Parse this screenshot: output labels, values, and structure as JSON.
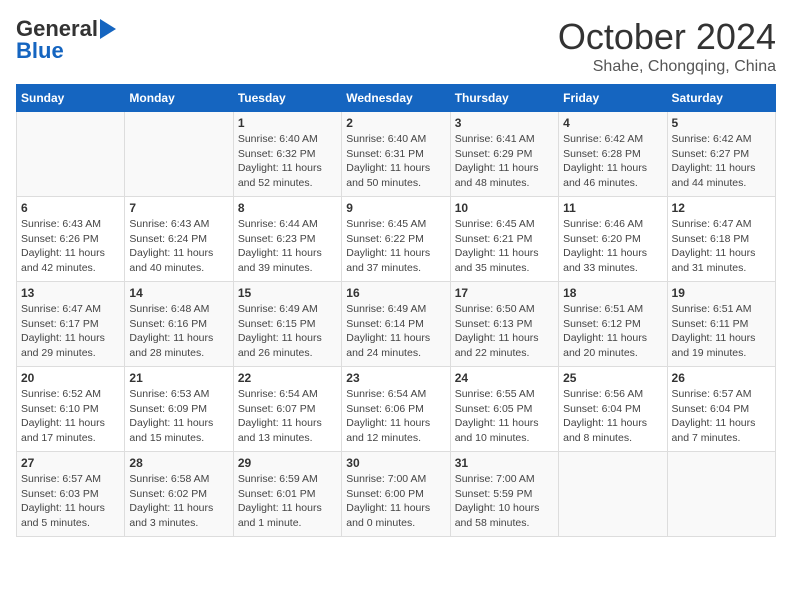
{
  "logo": {
    "general": "General",
    "blue": "Blue"
  },
  "title": {
    "month_year": "October 2024",
    "location": "Shahe, Chongqing, China"
  },
  "days_of_week": [
    "Sunday",
    "Monday",
    "Tuesday",
    "Wednesday",
    "Thursday",
    "Friday",
    "Saturday"
  ],
  "weeks": [
    [
      {
        "day": "",
        "info": ""
      },
      {
        "day": "",
        "info": ""
      },
      {
        "day": "1",
        "info": "Sunrise: 6:40 AM\nSunset: 6:32 PM\nDaylight: 11 hours and 52 minutes."
      },
      {
        "day": "2",
        "info": "Sunrise: 6:40 AM\nSunset: 6:31 PM\nDaylight: 11 hours and 50 minutes."
      },
      {
        "day": "3",
        "info": "Sunrise: 6:41 AM\nSunset: 6:29 PM\nDaylight: 11 hours and 48 minutes."
      },
      {
        "day": "4",
        "info": "Sunrise: 6:42 AM\nSunset: 6:28 PM\nDaylight: 11 hours and 46 minutes."
      },
      {
        "day": "5",
        "info": "Sunrise: 6:42 AM\nSunset: 6:27 PM\nDaylight: 11 hours and 44 minutes."
      }
    ],
    [
      {
        "day": "6",
        "info": "Sunrise: 6:43 AM\nSunset: 6:26 PM\nDaylight: 11 hours and 42 minutes."
      },
      {
        "day": "7",
        "info": "Sunrise: 6:43 AM\nSunset: 6:24 PM\nDaylight: 11 hours and 40 minutes."
      },
      {
        "day": "8",
        "info": "Sunrise: 6:44 AM\nSunset: 6:23 PM\nDaylight: 11 hours and 39 minutes."
      },
      {
        "day": "9",
        "info": "Sunrise: 6:45 AM\nSunset: 6:22 PM\nDaylight: 11 hours and 37 minutes."
      },
      {
        "day": "10",
        "info": "Sunrise: 6:45 AM\nSunset: 6:21 PM\nDaylight: 11 hours and 35 minutes."
      },
      {
        "day": "11",
        "info": "Sunrise: 6:46 AM\nSunset: 6:20 PM\nDaylight: 11 hours and 33 minutes."
      },
      {
        "day": "12",
        "info": "Sunrise: 6:47 AM\nSunset: 6:18 PM\nDaylight: 11 hours and 31 minutes."
      }
    ],
    [
      {
        "day": "13",
        "info": "Sunrise: 6:47 AM\nSunset: 6:17 PM\nDaylight: 11 hours and 29 minutes."
      },
      {
        "day": "14",
        "info": "Sunrise: 6:48 AM\nSunset: 6:16 PM\nDaylight: 11 hours and 28 minutes."
      },
      {
        "day": "15",
        "info": "Sunrise: 6:49 AM\nSunset: 6:15 PM\nDaylight: 11 hours and 26 minutes."
      },
      {
        "day": "16",
        "info": "Sunrise: 6:49 AM\nSunset: 6:14 PM\nDaylight: 11 hours and 24 minutes."
      },
      {
        "day": "17",
        "info": "Sunrise: 6:50 AM\nSunset: 6:13 PM\nDaylight: 11 hours and 22 minutes."
      },
      {
        "day": "18",
        "info": "Sunrise: 6:51 AM\nSunset: 6:12 PM\nDaylight: 11 hours and 20 minutes."
      },
      {
        "day": "19",
        "info": "Sunrise: 6:51 AM\nSunset: 6:11 PM\nDaylight: 11 hours and 19 minutes."
      }
    ],
    [
      {
        "day": "20",
        "info": "Sunrise: 6:52 AM\nSunset: 6:10 PM\nDaylight: 11 hours and 17 minutes."
      },
      {
        "day": "21",
        "info": "Sunrise: 6:53 AM\nSunset: 6:09 PM\nDaylight: 11 hours and 15 minutes."
      },
      {
        "day": "22",
        "info": "Sunrise: 6:54 AM\nSunset: 6:07 PM\nDaylight: 11 hours and 13 minutes."
      },
      {
        "day": "23",
        "info": "Sunrise: 6:54 AM\nSunset: 6:06 PM\nDaylight: 11 hours and 12 minutes."
      },
      {
        "day": "24",
        "info": "Sunrise: 6:55 AM\nSunset: 6:05 PM\nDaylight: 11 hours and 10 minutes."
      },
      {
        "day": "25",
        "info": "Sunrise: 6:56 AM\nSunset: 6:04 PM\nDaylight: 11 hours and 8 minutes."
      },
      {
        "day": "26",
        "info": "Sunrise: 6:57 AM\nSunset: 6:04 PM\nDaylight: 11 hours and 7 minutes."
      }
    ],
    [
      {
        "day": "27",
        "info": "Sunrise: 6:57 AM\nSunset: 6:03 PM\nDaylight: 11 hours and 5 minutes."
      },
      {
        "day": "28",
        "info": "Sunrise: 6:58 AM\nSunset: 6:02 PM\nDaylight: 11 hours and 3 minutes."
      },
      {
        "day": "29",
        "info": "Sunrise: 6:59 AM\nSunset: 6:01 PM\nDaylight: 11 hours and 1 minute."
      },
      {
        "day": "30",
        "info": "Sunrise: 7:00 AM\nSunset: 6:00 PM\nDaylight: 11 hours and 0 minutes."
      },
      {
        "day": "31",
        "info": "Sunrise: 7:00 AM\nSunset: 5:59 PM\nDaylight: 10 hours and 58 minutes."
      },
      {
        "day": "",
        "info": ""
      },
      {
        "day": "",
        "info": ""
      }
    ]
  ]
}
